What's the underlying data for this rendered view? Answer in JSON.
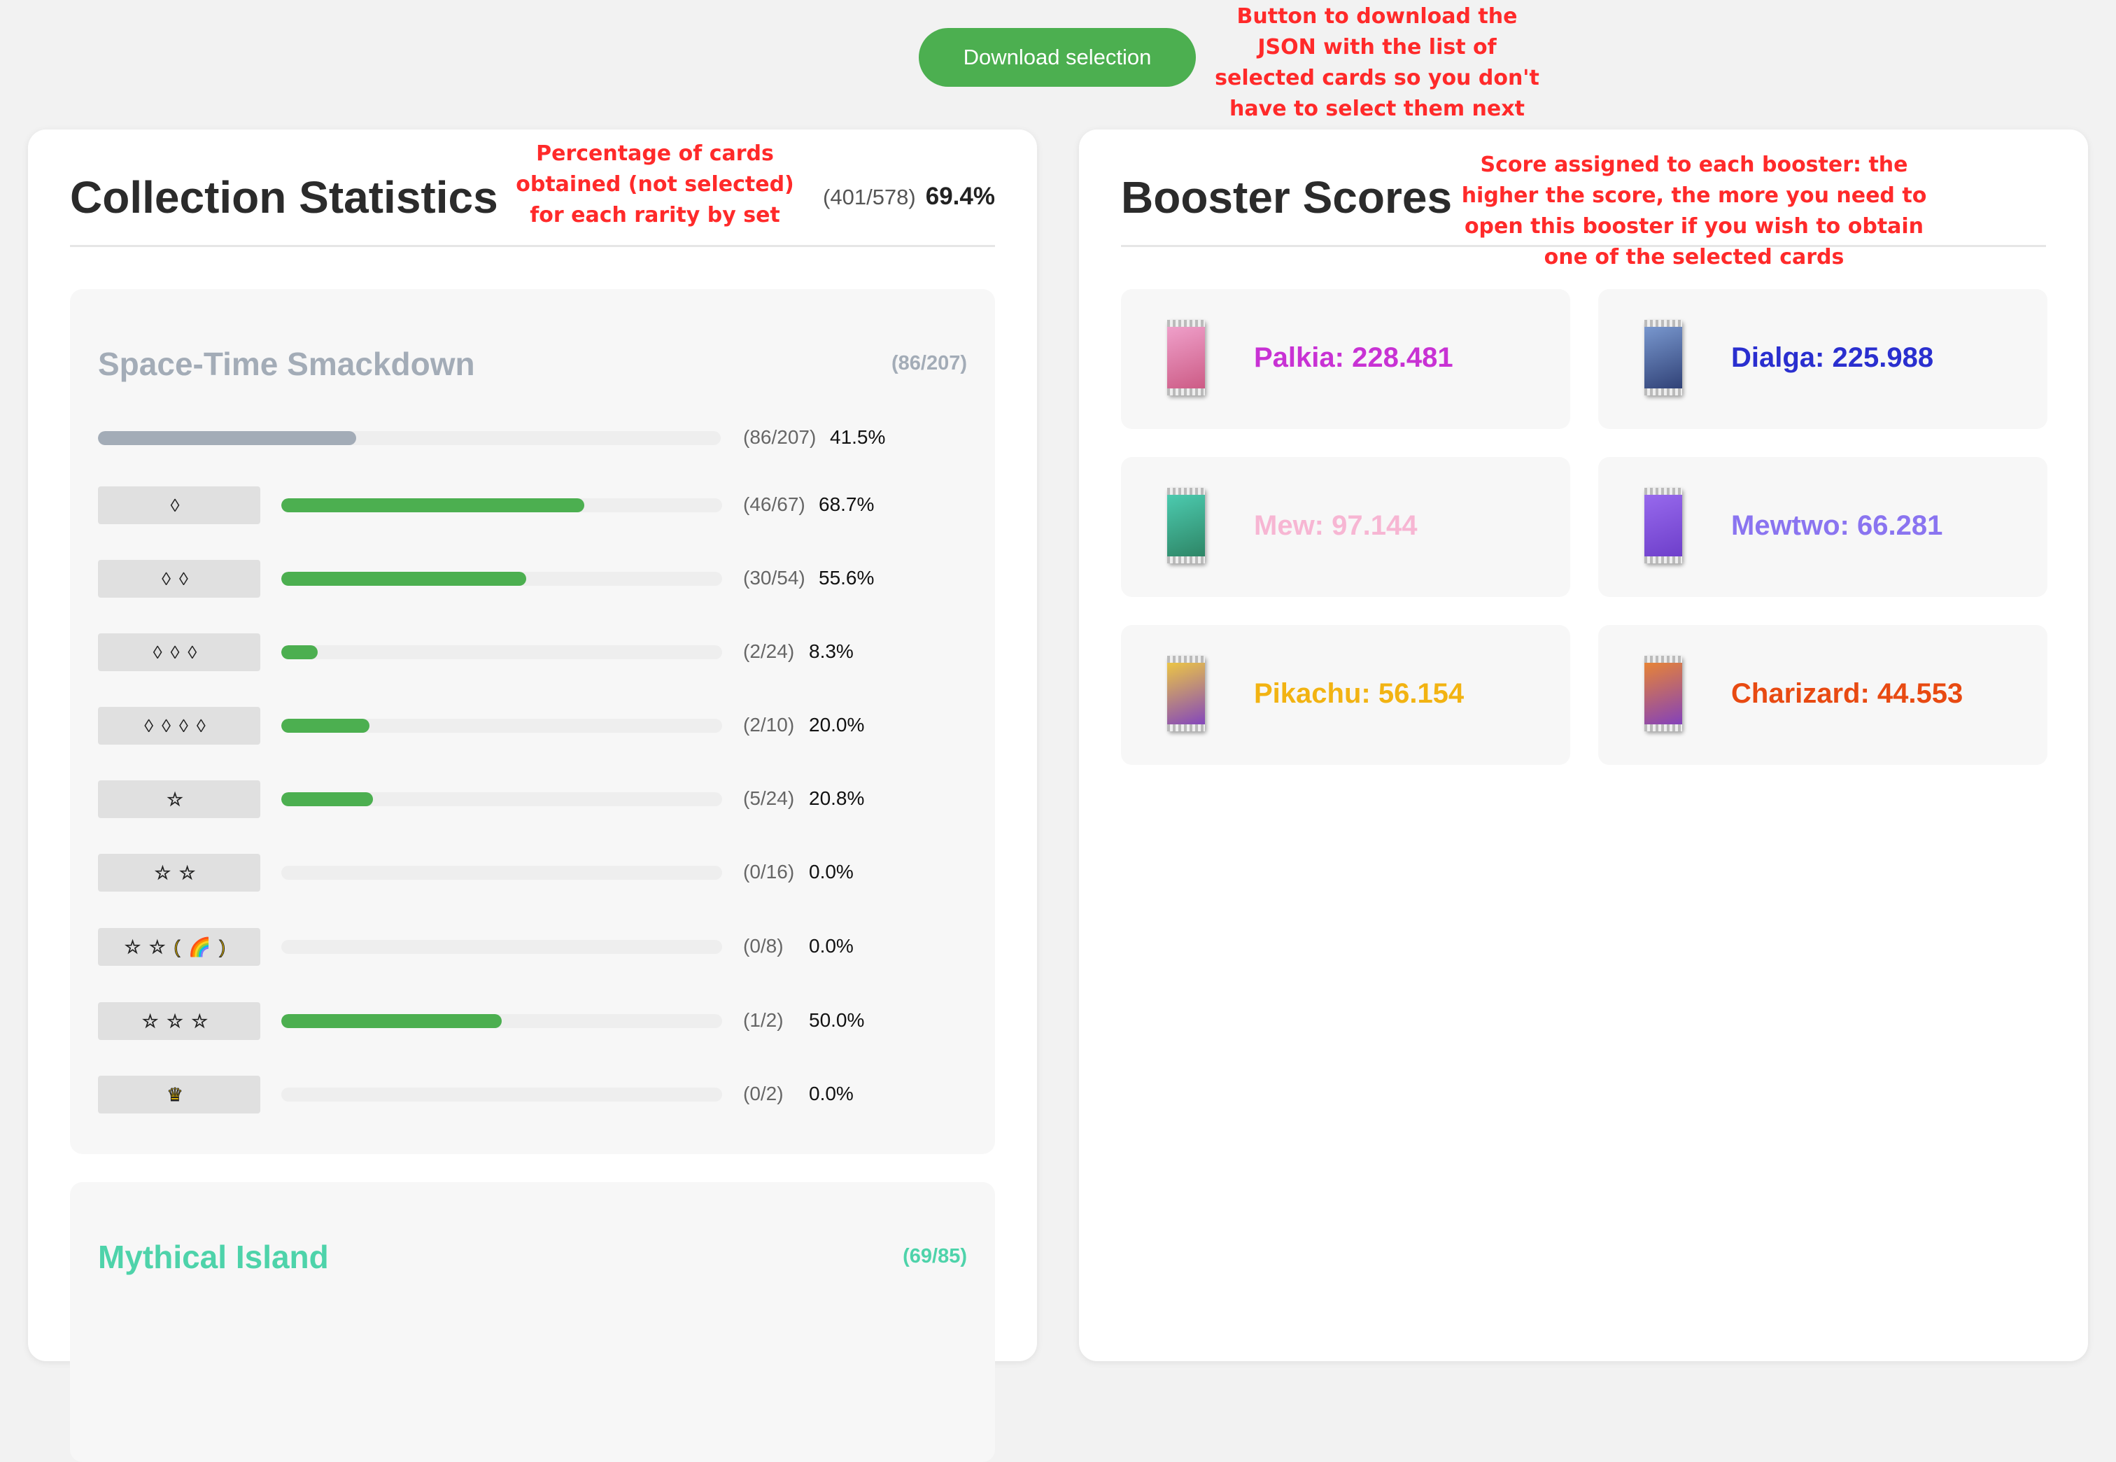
{
  "toolbar": {
    "download_label": "Download selection"
  },
  "annotations": {
    "download": "Button to download the JSON with the list of selected cards so you don't have to select them next time",
    "percentage": "Percentage of cards obtained (not selected) for each rarity by set",
    "score": "Score assigned to each booster: the higher the score, the more you need to open this booster if you wish to obtain one of the selected cards"
  },
  "stats": {
    "title": "Collection Statistics",
    "overall_count": "(401/578)",
    "overall_pct": "69.4%",
    "sets": [
      {
        "name": "Space-Time Smackdown",
        "count": "(86/207)",
        "color": "#a3acb7",
        "summary": {
          "count": "(86/207)",
          "pct": "41.5%",
          "fraction": 0.415
        },
        "rarities": [
          {
            "symbol": "◊",
            "type": "diamond",
            "count": "(46/67)",
            "pct": "68.7%",
            "fraction": 0.687
          },
          {
            "symbol": "◊◊",
            "type": "diamond",
            "count": "(30/54)",
            "pct": "55.6%",
            "fraction": 0.556
          },
          {
            "symbol": "◊◊◊",
            "type": "diamond",
            "count": "(2/24)",
            "pct": "8.3%",
            "fraction": 0.083
          },
          {
            "symbol": "◊◊◊◊",
            "type": "diamond",
            "count": "(2/10)",
            "pct": "20.0%",
            "fraction": 0.2
          },
          {
            "symbol": "☆",
            "type": "star",
            "count": "(5/24)",
            "pct": "20.8%",
            "fraction": 0.208
          },
          {
            "symbol": "☆☆",
            "type": "star",
            "count": "(0/16)",
            "pct": "0.0%",
            "fraction": 0
          },
          {
            "symbol": "☆☆(🌈)",
            "type": "star",
            "count": "(0/8)",
            "pct": "0.0%",
            "fraction": 0
          },
          {
            "symbol": "☆☆☆",
            "type": "star",
            "count": "(1/2)",
            "pct": "50.0%",
            "fraction": 0.5
          },
          {
            "symbol": "♛",
            "type": "crown",
            "count": "(0/2)",
            "pct": "0.0%",
            "fraction": 0
          }
        ]
      },
      {
        "name": "Mythical Island",
        "count": "(69/85)",
        "color": "#4ed3aa"
      }
    ]
  },
  "boosters": {
    "title": "Booster Scores",
    "items": [
      {
        "label": "Palkia: 228.481",
        "color": "#c832d4",
        "icon": "palkia-pack-icon",
        "pack_colors": [
          "#f2a6d0",
          "#c9557f"
        ]
      },
      {
        "label": "Dialga: 225.988",
        "color": "#2a2fcf",
        "icon": "dialga-pack-icon",
        "pack_colors": [
          "#7f9fd6",
          "#2a3a6f"
        ]
      },
      {
        "label": "Mew: 97.144",
        "color": "#f7b6d3",
        "icon": "mew-pack-icon",
        "pack_colors": [
          "#4fd1b6",
          "#2b7f5f"
        ]
      },
      {
        "label": "Mewtwo: 66.281",
        "color": "#8a74f0",
        "icon": "mewtwo-pack-icon",
        "pack_colors": [
          "#9b6df0",
          "#6a3bc7"
        ]
      },
      {
        "label": "Pikachu: 56.154",
        "color": "#f2b312",
        "icon": "pikachu-pack-icon",
        "pack_colors": [
          "#f5d13a",
          "#7a3bc7"
        ]
      },
      {
        "label": "Charizard: 44.553",
        "color": "#e84a12",
        "icon": "charizard-pack-icon",
        "pack_colors": [
          "#f08a2a",
          "#7a3bc7"
        ]
      }
    ]
  }
}
